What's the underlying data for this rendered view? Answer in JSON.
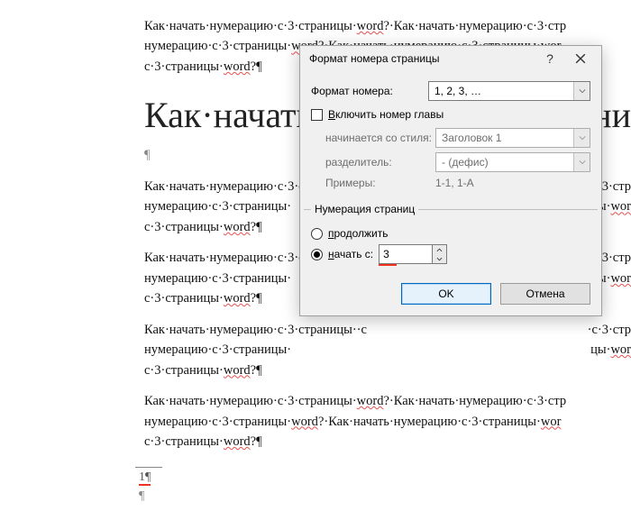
{
  "doc": {
    "paragraph": "Как·начать·нумерацию·с·3·страницы·word?·Как·начать·нумерацию·с·3·страницы·word?·Как·начать·нумерацию·с·3·страницы·word?·Как·начать·нумерацию·с·3·страницы·word?·Как·начать·нумерацию·с·3·страницы·word?¶",
    "paragraph_short_a": "Как·начать·нумерацию·с·3·страницы·",
    "paragraph_short_b": "?·Как·начать·нумерацию·с·3·стр",
    "paragraph_short_c": "нумерацию·с·3·страницы·",
    "paragraph_short_d": "?·Как·начать·нумерацию·с·3·страницы·",
    "paragraph_short_e": "с·3·страницы·",
    "paragraph_short_f": "?¶",
    "paragraph_right_a": "·с·3·стр",
    "paragraph_right_b": "цы·",
    "paragraph_right_c": "wor",
    "word_token": "word",
    "heading": "Как·начать·",
    "heading_right": "рани",
    "footer_mark": "1¶",
    "footer_mark2": "¶"
  },
  "dialog": {
    "title": "Формат номера страницы",
    "format_label": "Формат номера:",
    "format_value": "1, 2, 3, …",
    "include_chapter_label": "Включить номер главы",
    "include_chapter_mnemonic": "В",
    "start_style_label": "начинается со стиля:",
    "start_style_value": "Заголовок 1",
    "separator_label": "разделитель:",
    "separator_value": "-   (дефис)",
    "examples_label": "Примеры:",
    "examples_value": "1-1, 1-A",
    "group_title": "Нумерация страниц",
    "radio_continue": "продолжить",
    "radio_continue_mnemonic": "п",
    "radio_startat": "начать с:",
    "radio_startat_mnemonic": "н",
    "start_value": "3",
    "ok": "OK",
    "cancel": "Отмена"
  }
}
